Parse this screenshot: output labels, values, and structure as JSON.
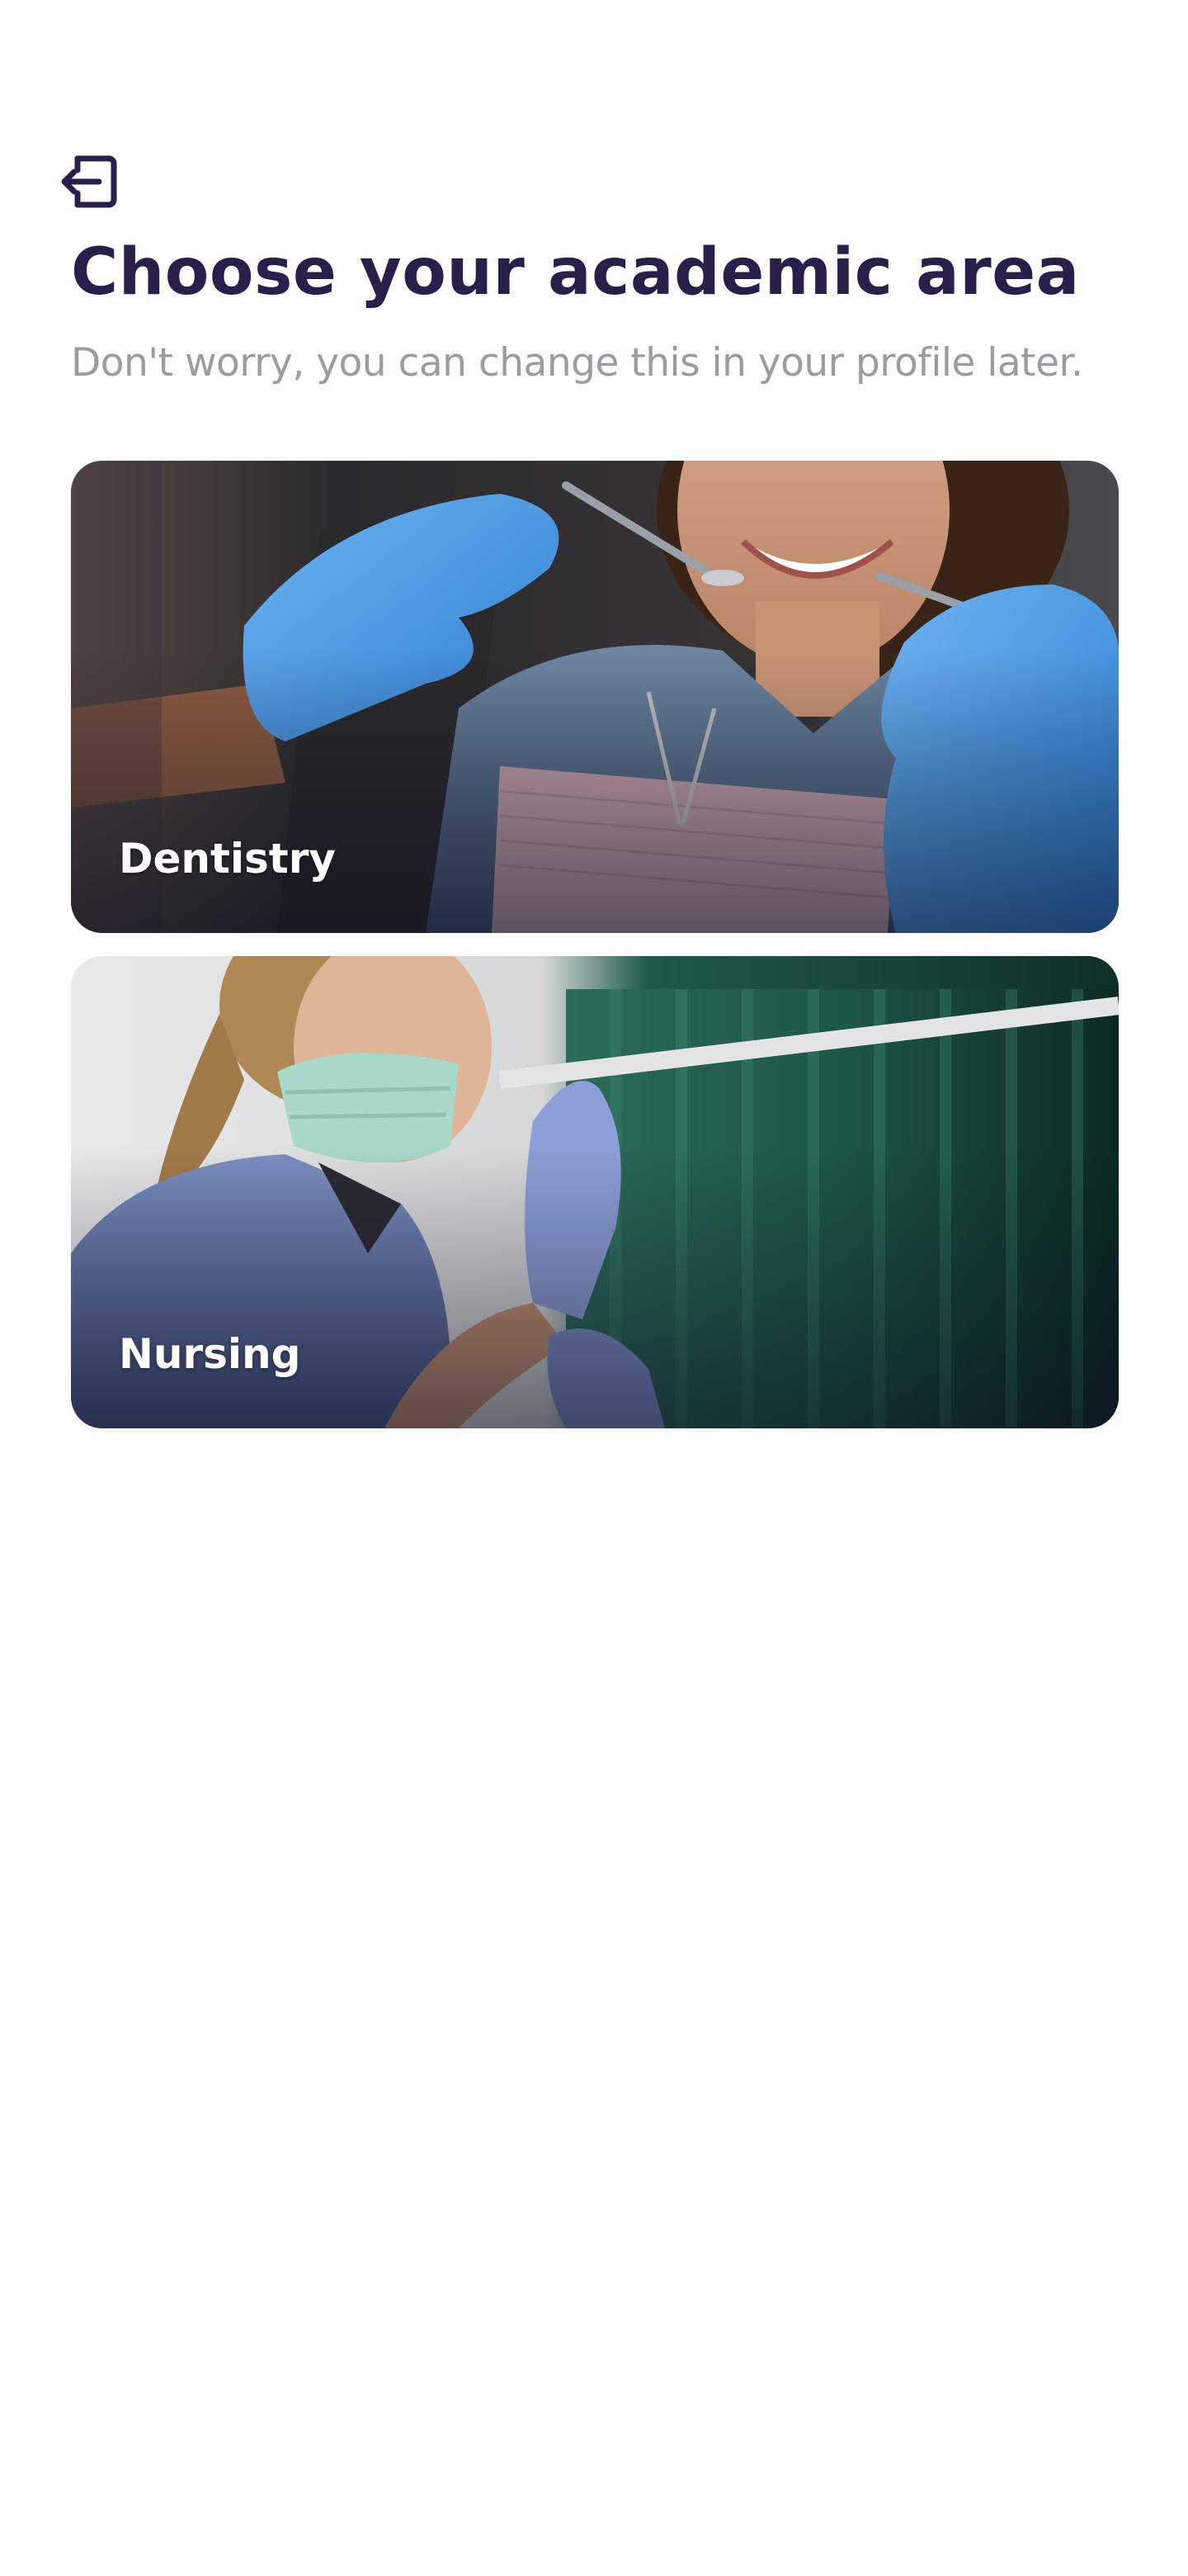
{
  "header": {
    "exit_icon": "logout-icon",
    "title": "Choose your academic area",
    "subtitle": "Don't worry, you can change this in your profile later."
  },
  "areas": [
    {
      "label": "Dentistry",
      "image": "dental-checkup-photo"
    },
    {
      "label": "Nursing",
      "image": "nurse-putting-on-gloves-photo"
    }
  ],
  "colors": {
    "title": "#2a1f4a",
    "subtitle": "#9b9ba1",
    "card_label": "#ffffff",
    "background": "#fefefe"
  }
}
